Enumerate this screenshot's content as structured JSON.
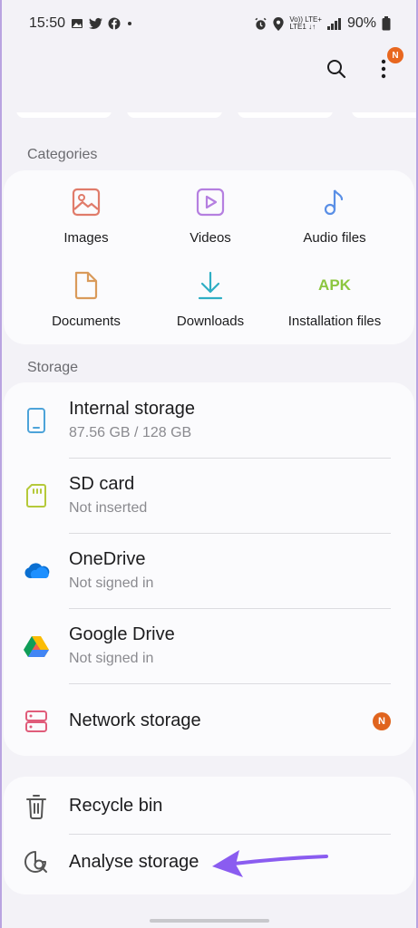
{
  "status_bar": {
    "time": "15:50",
    "volte_top": "Vo)) LTE+",
    "volte_bottom": "LTE1 ↓↑",
    "battery": "90%"
  },
  "toolbar": {
    "search_icon": "search-icon",
    "more_icon": "more-vertical-icon",
    "notification_badge": "N"
  },
  "categories": {
    "header": "Categories",
    "items": [
      {
        "label": "Images",
        "icon": "image-icon",
        "color": "#e07b6a"
      },
      {
        "label": "Videos",
        "icon": "video-icon",
        "color": "#b57fe0"
      },
      {
        "label": "Audio files",
        "icon": "music-icon",
        "color": "#5a8fe6"
      },
      {
        "label": "Documents",
        "icon": "document-icon",
        "color": "#d99a5a"
      },
      {
        "label": "Downloads",
        "icon": "download-icon",
        "color": "#2eaec4"
      },
      {
        "label": "Installation files",
        "icon": "apk-icon",
        "color": "#8cc63f",
        "icon_text": "APK"
      }
    ]
  },
  "storage": {
    "header": "Storage",
    "items": [
      {
        "title": "Internal storage",
        "subtitle": "87.56 GB / 128 GB",
        "icon": "phone-icon"
      },
      {
        "title": "SD card",
        "subtitle": "Not inserted",
        "icon": "sd-card-icon"
      },
      {
        "title": "OneDrive",
        "subtitle": "Not signed in",
        "icon": "onedrive-icon"
      },
      {
        "title": "Google Drive",
        "subtitle": "Not signed in",
        "icon": "google-drive-icon"
      },
      {
        "title": "Network storage",
        "subtitle": "",
        "icon": "network-storage-icon",
        "badge": "N"
      }
    ]
  },
  "utilities": {
    "items": [
      {
        "title": "Recycle bin",
        "icon": "trash-icon"
      },
      {
        "title": "Analyse storage",
        "icon": "analyse-storage-icon"
      }
    ]
  }
}
